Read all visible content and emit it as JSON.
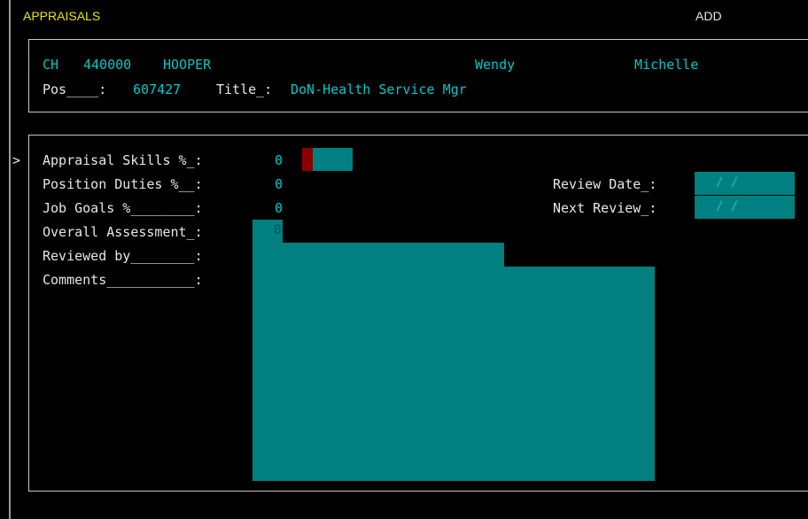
{
  "header": {
    "screen_title": "APPRAISALS",
    "mode": "ADD"
  },
  "employee": {
    "code": "CH",
    "number": "440000",
    "surname": "HOOPER",
    "first_name": "Wendy",
    "middle_name": "Michelle",
    "pos_label": "Pos____:",
    "pos_value": "607427",
    "title_label": "Title_:",
    "title_value": "DoN-Health Service Mgr"
  },
  "form": {
    "cursor": ">",
    "appraisal_skills_label": "Appraisal Skills %_:",
    "appraisal_skills_value": "0",
    "position_duties_label": "Position Duties %__:",
    "position_duties_value": "0",
    "job_goals_label": "Job Goals %________:",
    "job_goals_value": "0",
    "overall_assessment_label": "Overall Assessment_:",
    "overall_assessment_value": "0",
    "reviewed_by_label": "Reviewed by________:",
    "comments_label": "Comments___________:",
    "review_date_label": "Review Date_:",
    "review_date_value": "/ /",
    "next_review_label": "Next Review_:",
    "next_review_value": "/ /"
  }
}
